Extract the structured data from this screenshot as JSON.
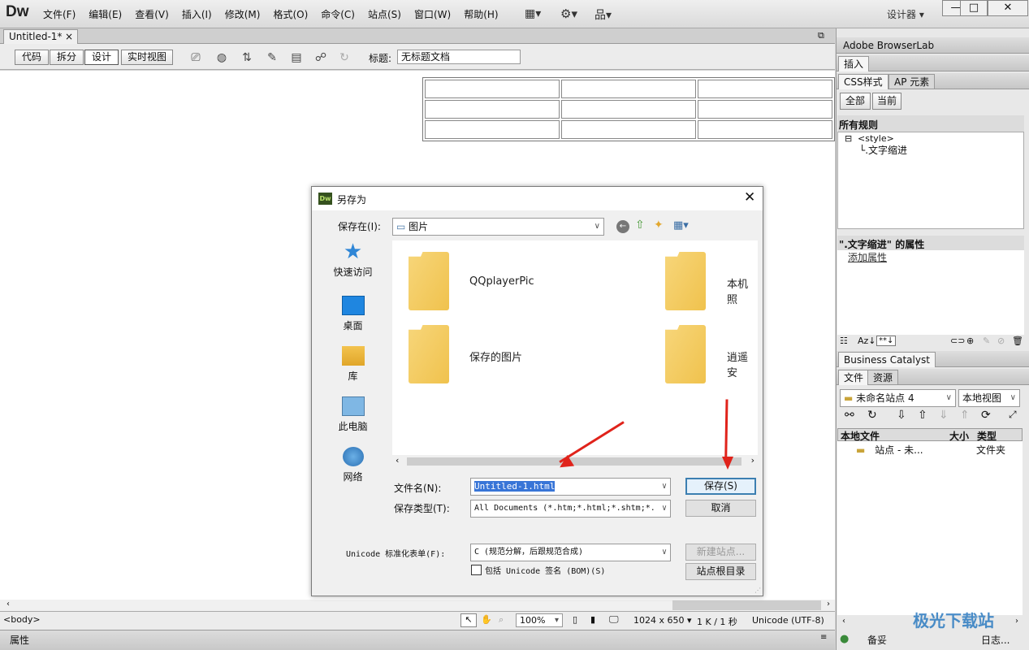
{
  "app": {
    "logo": "Dw",
    "workspace": "设计器 ▾"
  },
  "menu": [
    "文件(F)",
    "编辑(E)",
    "查看(V)",
    "插入(I)",
    "修改(M)",
    "格式(O)",
    "命令(C)",
    "站点(S)",
    "窗口(W)",
    "帮助(H)"
  ],
  "tab": {
    "title": "Untitled-1*",
    "close": "×"
  },
  "toolbar": {
    "views": [
      "代码",
      "拆分",
      "设计",
      "实时视图"
    ],
    "title_label": "标题:",
    "title_value": "无标题文档"
  },
  "status": {
    "tag": "<body>",
    "zoom": "100%",
    "size": "1024 x 650 ▾",
    "filesize": "1 K / 1 秒",
    "encoding": "Unicode (UTF-8)"
  },
  "props": {
    "label": "属性"
  },
  "panel": {
    "browserlab": "Adobe BrowserLab",
    "insert": "插入",
    "css_tabs": [
      "CSS样式",
      "AP 元素"
    ],
    "css_modes": [
      "全部",
      "当前"
    ],
    "all_rules": "所有规则",
    "rule_style": "<style>",
    "rule_item": "└.文字缩进",
    "props_title": "\".文字缩进\" 的属性",
    "add_prop": "添加属性",
    "bc": "Business Catalyst",
    "file_tabs": [
      "文件",
      "资源"
    ],
    "site": "未命名站点 4",
    "view": "本地视图",
    "cols": [
      "本地文件",
      "大小",
      "类型"
    ],
    "row": {
      "name": "站点 - 未...",
      "type": "文件夹"
    },
    "bottom": [
      "备妥",
      "日志..."
    ]
  },
  "dialog": {
    "title": "另存为",
    "save_in_label": "保存在(I):",
    "save_in": "图片",
    "places": [
      "快速访问",
      "桌面",
      "库",
      "此电脑",
      "网络"
    ],
    "files": [
      "QQplayerPic",
      "本机照",
      "保存的图片",
      "逍遥安"
    ],
    "filename_label": "文件名(N):",
    "filename": "Untitled-1.html",
    "type_label": "保存类型(T):",
    "type": "All Documents (*.htm;*.html;*.shtm;*.",
    "save": "保存(S)",
    "cancel": "取消",
    "unicode_label": "Unicode 标准化表单(F):",
    "unicode": "C (规范分解，后跟规范合成)",
    "bom": "包括 Unicode 签名 (BOM)(S)",
    "new_site": "新建站点...",
    "site_root": "站点根目录"
  },
  "watermark": "极光下载站",
  "colors": {
    "accent": "#3c7fb1",
    "arrow": "#e0231b"
  }
}
